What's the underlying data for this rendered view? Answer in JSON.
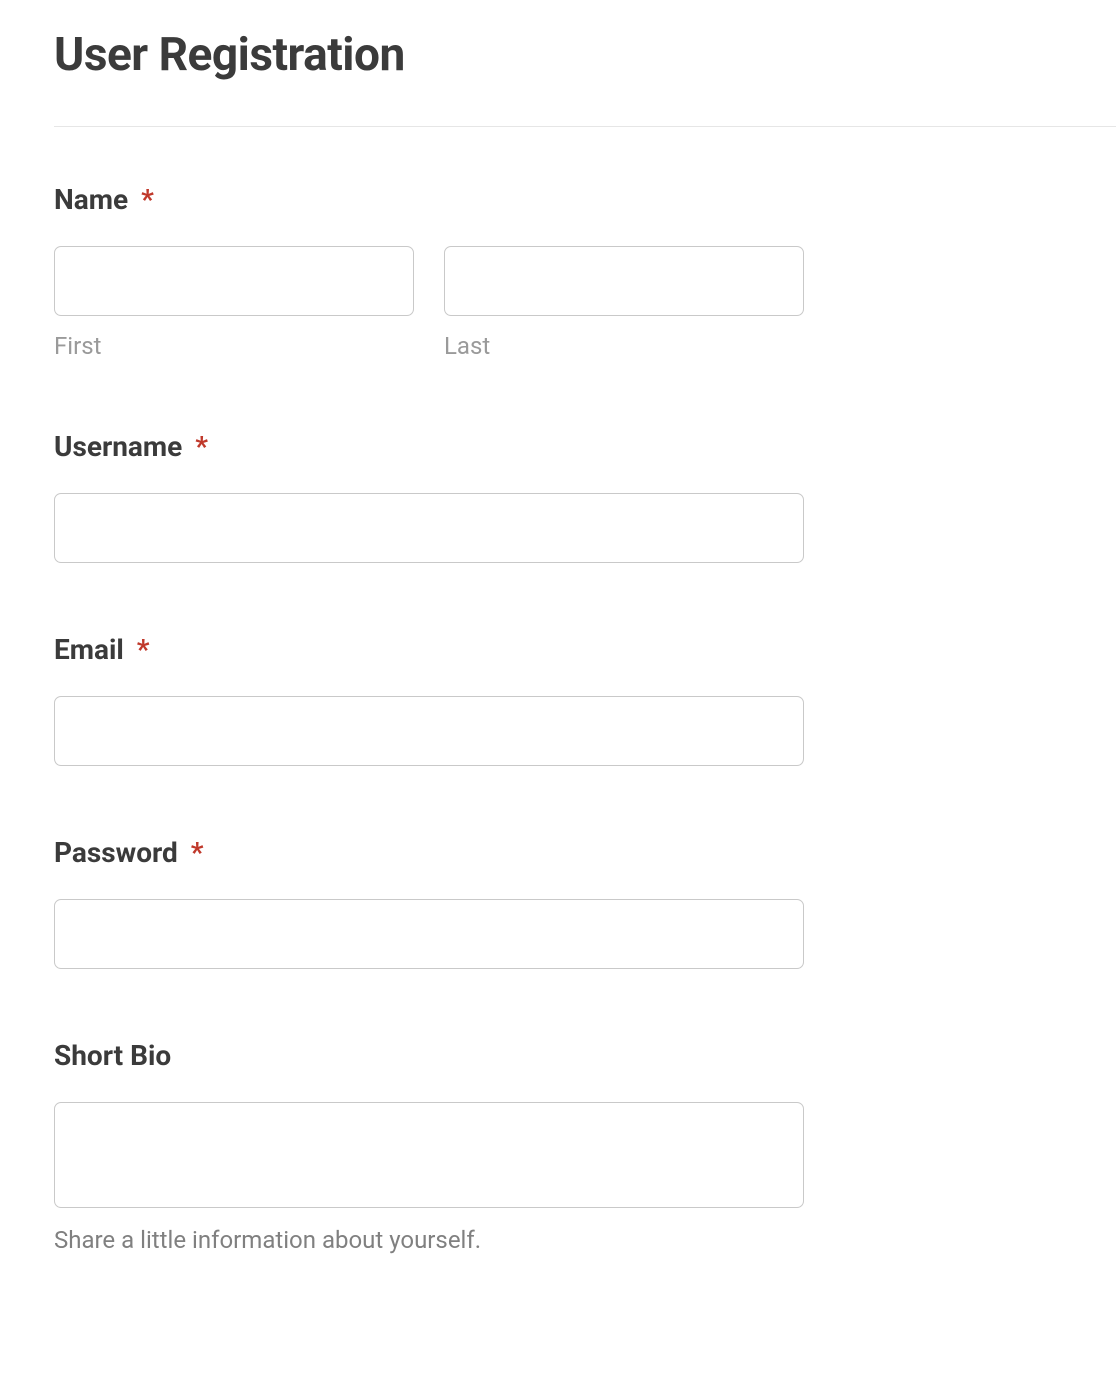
{
  "title": "User Registration",
  "required_marker": "*",
  "fields": {
    "name": {
      "label": "Name",
      "required": true,
      "first_sub": "First",
      "last_sub": "Last",
      "first_value": "",
      "last_value": ""
    },
    "username": {
      "label": "Username",
      "required": true,
      "value": ""
    },
    "email": {
      "label": "Email",
      "required": true,
      "value": ""
    },
    "password": {
      "label": "Password",
      "required": true,
      "value": ""
    },
    "bio": {
      "label": "Short Bio",
      "required": false,
      "value": "",
      "helper": "Share a little information about yourself."
    }
  }
}
